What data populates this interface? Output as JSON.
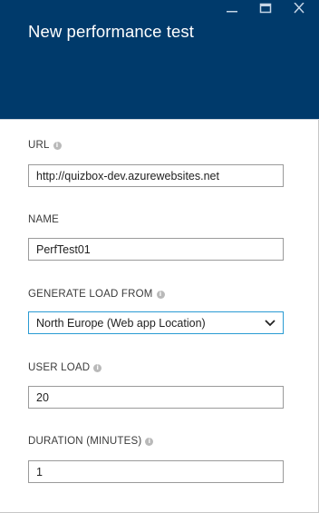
{
  "header": {
    "title": "New performance test",
    "window_controls": {
      "minimize_icon": "minimize-icon",
      "maximize_icon": "maximize-icon",
      "close_icon": "close-icon"
    }
  },
  "form": {
    "url": {
      "label": "URL",
      "value": "http://quizbox-dev.azurewebsites.net"
    },
    "name": {
      "label": "NAME",
      "value": "PerfTest01"
    },
    "generate_load_from": {
      "label": "GENERATE LOAD FROM",
      "selected": "North Europe (Web app Location)"
    },
    "user_load": {
      "label": "USER LOAD",
      "value": "20"
    },
    "duration": {
      "label": "DURATION (MINUTES)",
      "value": "1"
    },
    "info_icon_glyph": "i"
  },
  "colors": {
    "header_bg": "#003a6b",
    "select_border": "#2a9bd3",
    "input_border": "#9a9a9a"
  }
}
